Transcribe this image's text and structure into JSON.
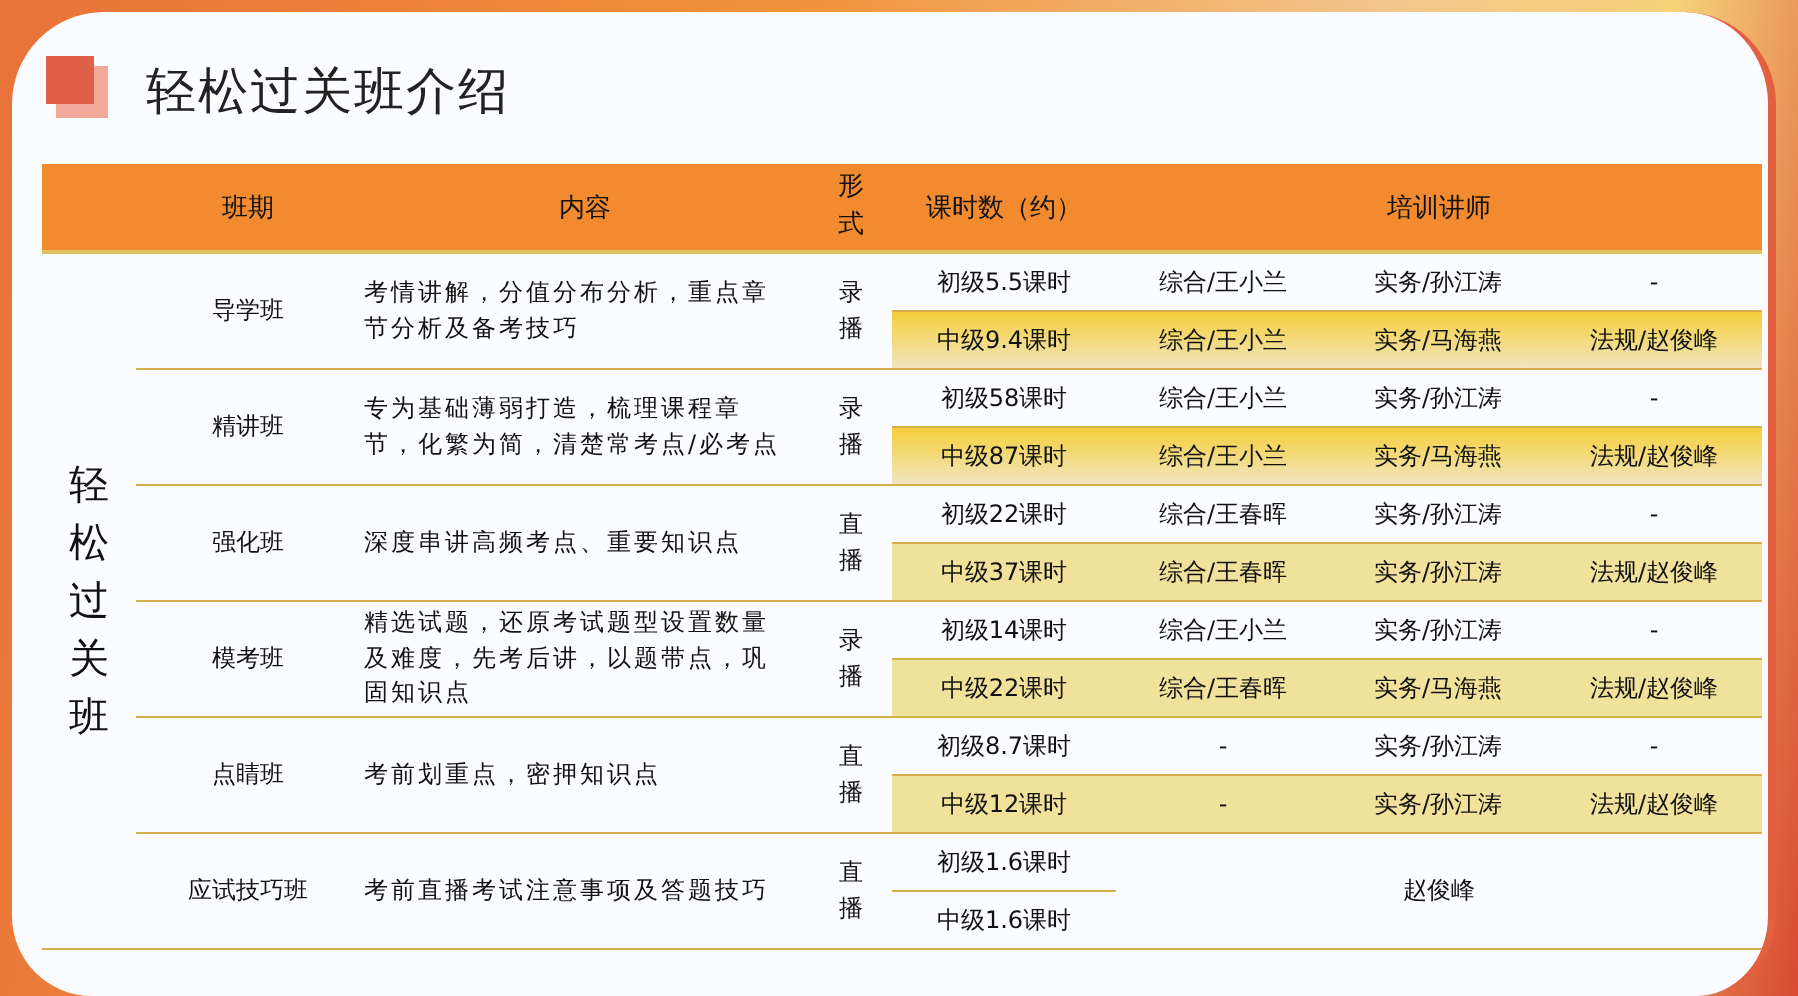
{
  "title": "轻松过关班介绍",
  "table": {
    "columns": [
      "班期",
      "内容",
      "形式",
      "课时数（约）",
      "培训讲师"
    ],
    "group_label": "轻松过关班",
    "rows": [
      {
        "name": "导学班",
        "content": "考情讲解，分值分布分析，重点章节分析及备考技巧",
        "format": "录播",
        "kind": "split",
        "levels": [
          {
            "kind": "plain",
            "hours": "初级5.5课时",
            "teachers": [
              "综合/王小兰",
              "实务/孙江涛",
              "-"
            ]
          },
          {
            "kind": "gradient",
            "hours": "中级9.4课时",
            "teachers": [
              "综合/王小兰",
              "实务/马海燕",
              "法规/赵俊峰"
            ]
          }
        ]
      },
      {
        "name": "精讲班",
        "content": "专为基础薄弱打造，梳理课程章节，化繁为简，清楚常考点/必考点",
        "format": "录播",
        "kind": "split",
        "levels": [
          {
            "kind": "plain",
            "hours": "初级58课时",
            "teachers": [
              "综合/王小兰",
              "实务/孙江涛",
              "-"
            ]
          },
          {
            "kind": "gradient",
            "hours": "中级87课时",
            "teachers": [
              "综合/王小兰",
              "实务/马海燕",
              "法规/赵俊峰"
            ]
          }
        ]
      },
      {
        "name": "强化班",
        "content": "深度串讲高频考点、重要知识点",
        "format": "直播",
        "kind": "split",
        "levels": [
          {
            "kind": "plain",
            "hours": "初级22课时",
            "teachers": [
              "综合/王春晖",
              "实务/孙江涛",
              "-"
            ]
          },
          {
            "kind": "flat",
            "hours": "中级37课时",
            "teachers": [
              "综合/王春晖",
              "实务/孙江涛",
              "法规/赵俊峰"
            ]
          }
        ]
      },
      {
        "name": "模考班",
        "content": "精选试题，还原考试题型设置数量及难度，先考后讲，以题带点，巩固知识点",
        "format": "录播",
        "kind": "split",
        "levels": [
          {
            "kind": "plain",
            "hours": "初级14课时",
            "teachers": [
              "综合/王小兰",
              "实务/孙江涛",
              "-"
            ]
          },
          {
            "kind": "flat",
            "hours": "中级22课时",
            "teachers": [
              "综合/王春晖",
              "实务/马海燕",
              "法规/赵俊峰"
            ]
          }
        ]
      },
      {
        "name": "点睛班",
        "content": "考前划重点，密押知识点",
        "format": "直播",
        "kind": "split",
        "levels": [
          {
            "kind": "plain",
            "hours": "初级8.7课时",
            "teachers": [
              "-",
              "实务/孙江涛",
              "-"
            ]
          },
          {
            "kind": "flat",
            "hours": "中级12课时",
            "teachers": [
              "-",
              "实务/孙江涛",
              "法规/赵俊峰"
            ]
          }
        ]
      },
      {
        "name": "应试技巧班",
        "content": "考前直播考试注意事项及答题技巧",
        "format": "直播",
        "kind": "merged",
        "levels": [
          {
            "kind": "plain",
            "hours": "初级1.6课时"
          },
          {
            "kind": "plain",
            "hours": "中级1.6课时"
          }
        ],
        "teacher": "赵俊峰"
      }
    ]
  }
}
